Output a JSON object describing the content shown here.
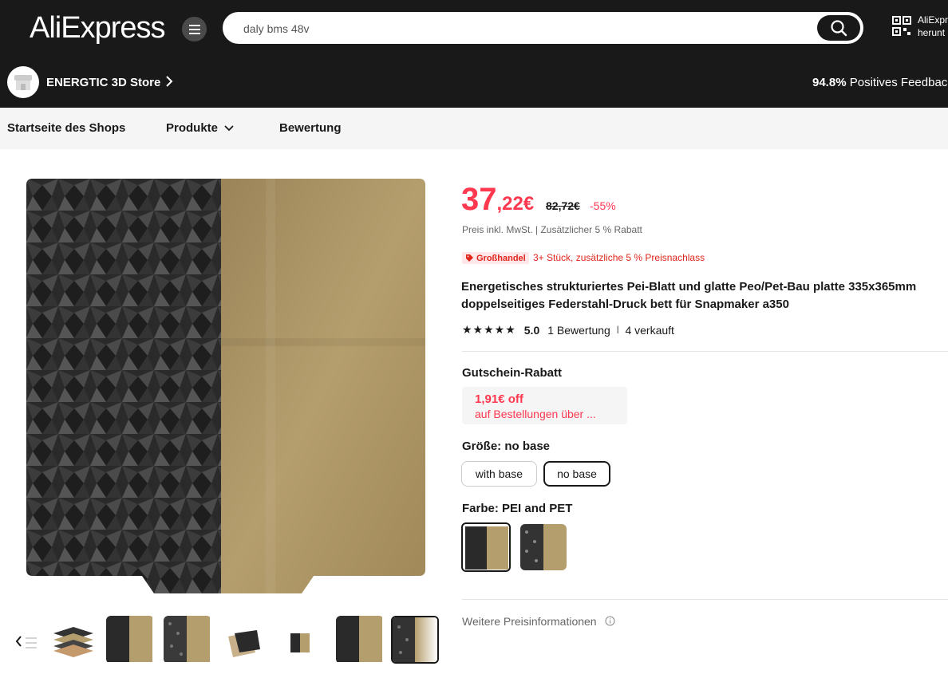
{
  "header": {
    "logo": "AliExpress",
    "search_value": "daly bms 48v",
    "app_promo_line1": "AliExpr",
    "app_promo_line2": "herunt"
  },
  "store": {
    "name": "ENERGTIC 3D Store",
    "feedback_percent": "94.8%",
    "feedback_label": "Positives Feedbac"
  },
  "nav": {
    "home": "Startseite des Shops",
    "products": "Produkte",
    "reviews": "Bewertung"
  },
  "product": {
    "price_int": "37",
    "price_dec": ",22€",
    "price_old": "82,72€",
    "discount": "-55%",
    "tax_note": "Preis inkl. MwSt. | Zusätzlicher 5 % Rabatt",
    "wholesale_badge": "Großhandel",
    "wholesale_text": "3+ Stück, zusätzliche 5 % Preisnachlass",
    "title": "Energetisches strukturiertes Pei-Blatt und glatte Peo/Pet-Bau platte 335x365mm doppelseitiges Federstahl-Druck bett für Snapmaker a350",
    "rating": "5.0",
    "reviews": "1 Bewertung",
    "sold": "4 verkauft",
    "coupon_title": "Gutschein-Rabatt",
    "coupon_amount": "1,91€ off",
    "coupon_desc": "auf Bestellungen über ...",
    "size_label": "Größe: no base",
    "size_options": [
      "with base",
      "no base"
    ],
    "color_label": "Farbe: PEI and PET",
    "more_price_info": "Weitere Preisinformationen"
  },
  "colors": {
    "brand_dark": "#191919",
    "price_red": "#fd384f",
    "gold": "#a89064"
  },
  "icons": [
    "menu-icon",
    "search-icon",
    "qr-code-icon",
    "chevron-right-icon",
    "chevron-down-icon",
    "star-icon",
    "tag-icon",
    "info-icon"
  ]
}
